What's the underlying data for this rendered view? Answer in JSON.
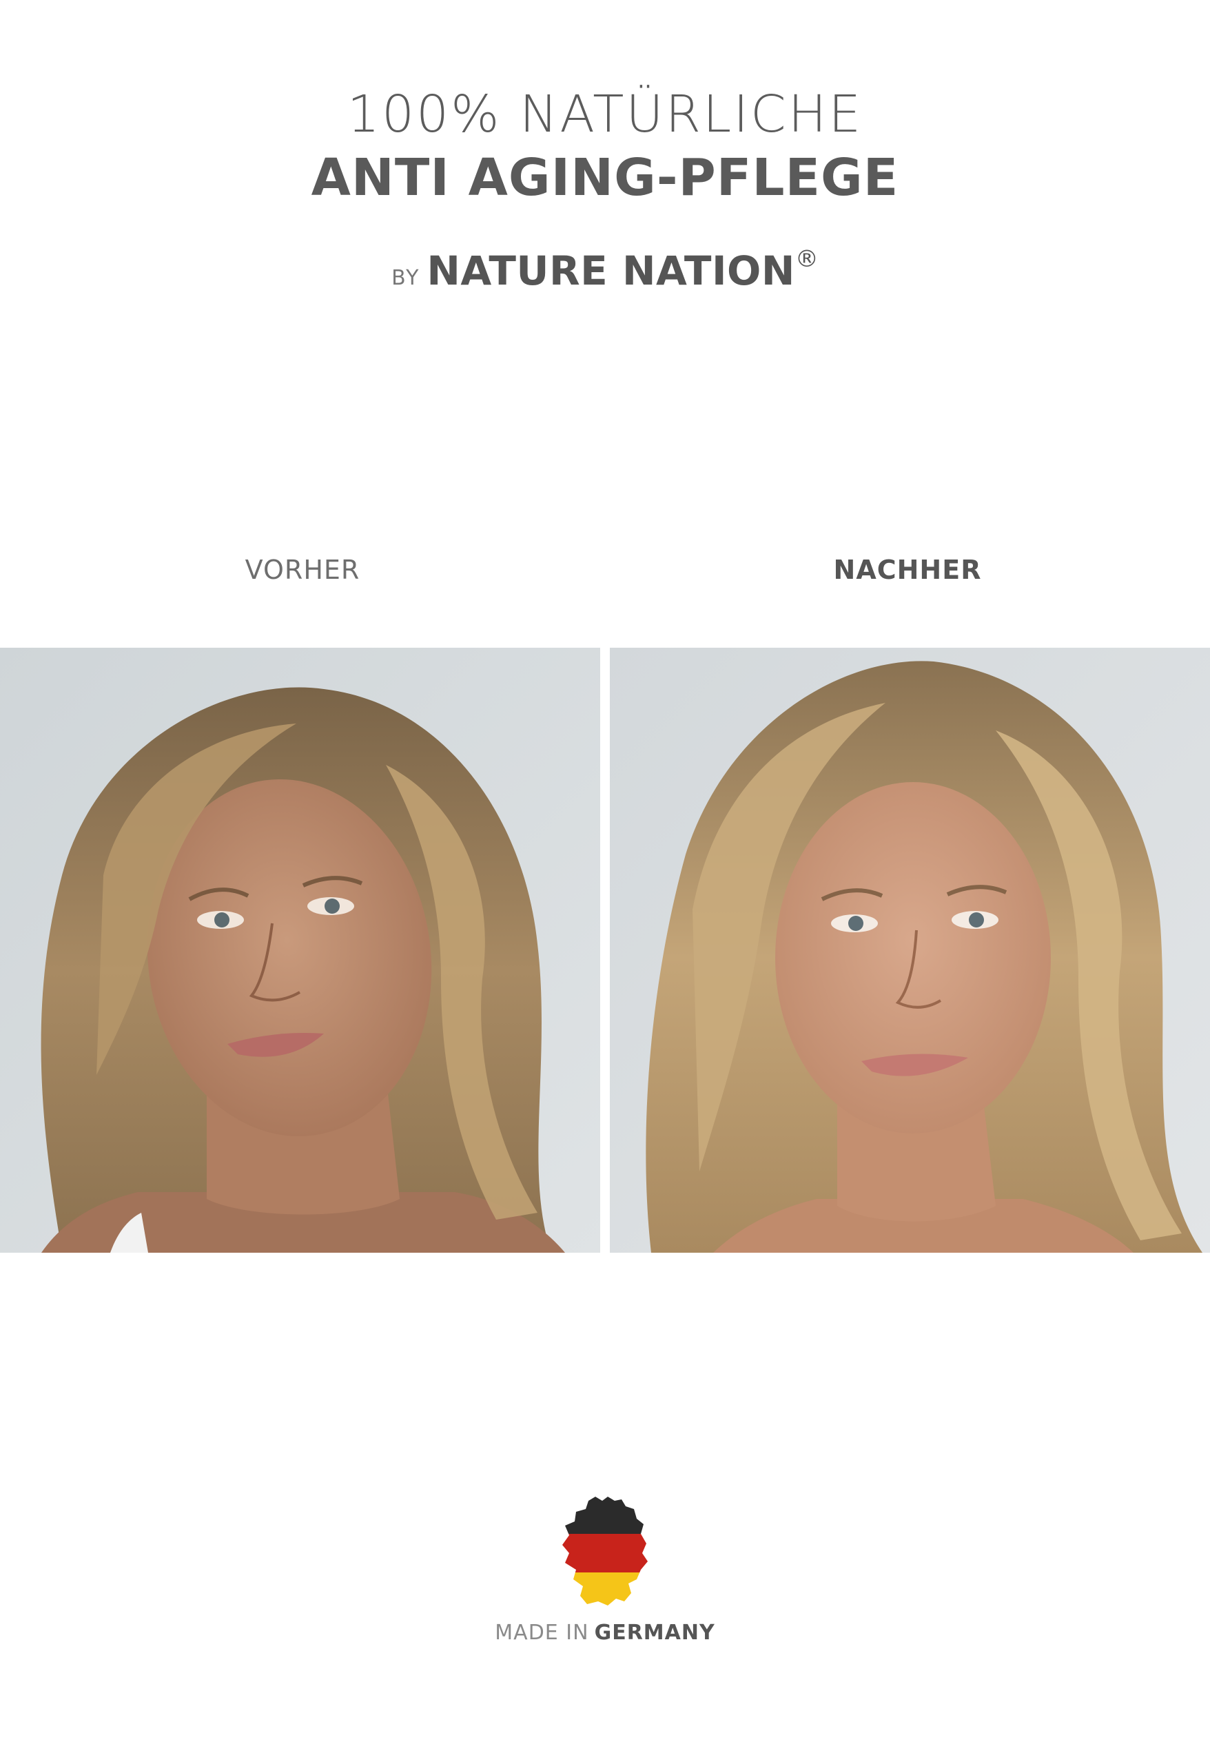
{
  "header": {
    "headline_line1": "100% NATÜRLICHE",
    "headline_line2": "ANTI AGING-PFLEGE",
    "by_label": "BY",
    "brand_name": "NATURE NATION",
    "registered_mark": "®"
  },
  "comparison": {
    "before_label": "VORHER",
    "after_label": "NACHHER"
  },
  "footer": {
    "made_in_light": "MADE IN",
    "made_in_bold": "GERMANY",
    "map_icon": "germany-flag-map-icon",
    "flag_colors": [
      "#2b2b2b",
      "#c8231b",
      "#f5c518"
    ]
  },
  "colors": {
    "text_dark": "#555555",
    "text_light": "#8a8a8a",
    "background": "#ffffff",
    "photo_background": "#d4d9dc"
  }
}
